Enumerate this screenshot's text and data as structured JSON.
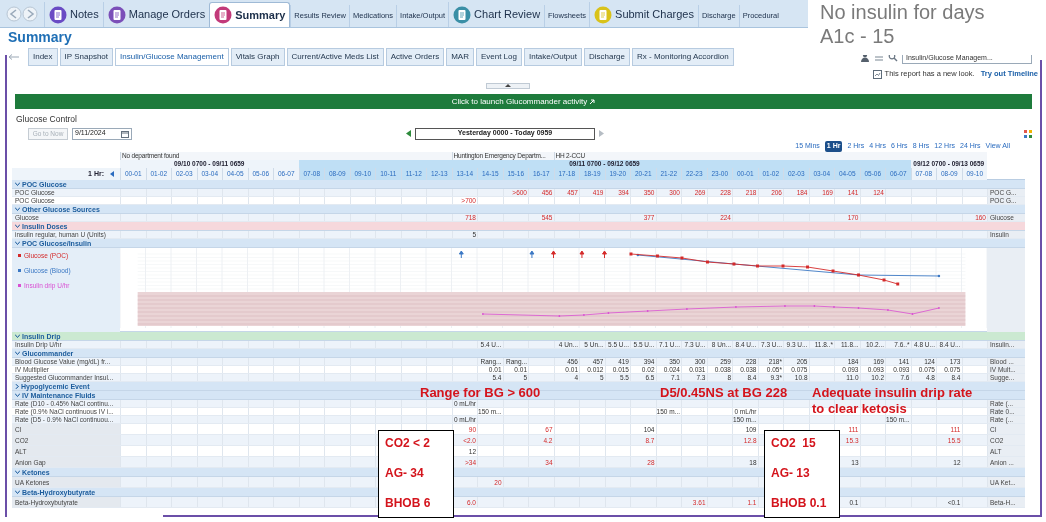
{
  "top_tabs": [
    {
      "label": "Notes",
      "kind": "large",
      "selected": false,
      "color": "#6a4bc4"
    },
    {
      "label": "Manage Orders",
      "kind": "large",
      "selected": false,
      "color": "#7b4fb8"
    },
    {
      "label": "Summary",
      "kind": "large",
      "selected": true,
      "color": "#c23a7a"
    },
    {
      "label": "Results Review",
      "kind": "small",
      "selected": false
    },
    {
      "label": "Medications",
      "kind": "small",
      "selected": false
    },
    {
      "label": "Intake/Output",
      "kind": "small",
      "selected": false
    },
    {
      "label": "Chart Review",
      "kind": "large",
      "selected": false,
      "color": "#3a8fa6"
    },
    {
      "label": "Flowsheets",
      "kind": "small",
      "selected": false
    },
    {
      "label": "Submit Charges",
      "kind": "large",
      "selected": false,
      "color": "#d9c21a"
    },
    {
      "label": "Discharge",
      "kind": "small",
      "selected": false
    },
    {
      "label": "Procedural",
      "kind": "small",
      "selected": false
    }
  ],
  "overlay_note": [
    "No insulin for days",
    "A1c - 15"
  ],
  "page_title": "Summary",
  "report_tabs": [
    {
      "label": "Index",
      "selected": false
    },
    {
      "label": "IP Snapshot",
      "selected": false
    },
    {
      "label": "Insulin/Glucose Management",
      "selected": true
    },
    {
      "label": "Vitals Graph",
      "selected": false
    },
    {
      "label": "Current/Active Meds List",
      "selected": false
    },
    {
      "label": "Active Orders",
      "selected": false
    },
    {
      "label": "MAR",
      "selected": false
    },
    {
      "label": "Event Log",
      "selected": false
    },
    {
      "label": "Intake/Output",
      "selected": false
    },
    {
      "label": "Discharge",
      "selected": false
    },
    {
      "label": "Rx - Monitoring Accordion",
      "selected": false
    }
  ],
  "report_search": {
    "value": "Insulin/Glucose Managem..."
  },
  "new_look": {
    "text": "This report has a new look.",
    "link": "Try out Timeline"
  },
  "launch_bar": "Click to launch Glucommander activity",
  "section_title": "Glucose Control",
  "go_to_now": {
    "label": "Go to Now",
    "disabled": true
  },
  "date_field": {
    "value": "9/11/2024"
  },
  "range_nav": "Yesterday 0000 - Today 0959",
  "intervals": [
    {
      "label": "15 Mins",
      "selected": false
    },
    {
      "label": "1 Hr",
      "selected": true
    },
    {
      "label": "2 Hrs",
      "selected": false
    },
    {
      "label": "4 Hrs",
      "selected": false
    },
    {
      "label": "6 Hrs",
      "selected": false
    },
    {
      "label": "8 Hrs",
      "selected": false
    },
    {
      "label": "12 Hrs",
      "selected": false
    },
    {
      "label": "24 Hrs",
      "selected": false
    },
    {
      "label": "View All",
      "selected": false
    }
  ],
  "department_cells": [
    "No department found",
    null,
    null,
    null,
    null,
    null,
    null,
    null,
    null,
    null,
    null,
    null,
    null,
    "Huntington Emergency Departm...",
    null,
    null,
    null,
    "HH 2-CCU",
    null,
    null,
    null,
    null,
    null,
    null,
    null,
    null,
    null,
    null,
    null,
    null,
    null,
    null,
    null,
    null
  ],
  "periods": [
    {
      "label": "09/10 0700 - 09/11 0659",
      "selected": false,
      "columns": [
        "00-01",
        "01-02",
        "02-03",
        "03-04",
        "04-05",
        "05-06",
        "06-07"
      ]
    },
    {
      "label": "09/11 0700 - 09/12 0659",
      "selected": true,
      "columns": [
        "07-08",
        "08-09",
        "09-10",
        "10-11",
        "11-12",
        "12-13",
        "13-14",
        "14-15",
        "15-16",
        "16-17",
        "17-18",
        "18-19",
        "19-20",
        "20-21",
        "21-22",
        "22-23",
        "23-00",
        "00-01",
        "01-02",
        "02-03",
        "03-04",
        "04-05",
        "05-06",
        "06-07"
      ]
    },
    {
      "label": "09/12 0700 - 09/13 0659",
      "selected": false,
      "columns": [
        "07-08",
        "08-09",
        "09-10"
      ]
    }
  ],
  "column_unit": "1 Hr:",
  "body": [
    {
      "kind": "section",
      "title": "POC Glucose",
      "expanded": true,
      "color": "#d5e5f5"
    },
    {
      "kind": "flowsheet",
      "label": "POC Glucose",
      "right_label": "POC G...",
      "cells": [
        null,
        null,
        null,
        null,
        null,
        null,
        null,
        null,
        null,
        null,
        null,
        null,
        null,
        null,
        null,
        {
          "text": ">600",
          "abnormal": true
        },
        {
          "text": "456",
          "abnormal": true
        },
        {
          "text": "457",
          "abnormal": true
        },
        {
          "text": "419",
          "abnormal": true
        },
        {
          "text": "394",
          "abnormal": true
        },
        {
          "text": "350",
          "abnormal": true
        },
        {
          "text": "300",
          "abnormal": true
        },
        {
          "text": "269",
          "abnormal": true
        },
        {
          "text": "228",
          "abnormal": true
        },
        {
          "text": "218",
          "abnormal": true
        },
        {
          "text": "206",
          "abnormal": true
        },
        {
          "text": "184",
          "abnormal": true
        },
        {
          "text": "169",
          "abnormal": true
        },
        {
          "text": "141",
          "abnormal": true
        },
        {
          "text": "124",
          "abnormal": true
        },
        null,
        null,
        null,
        null
      ]
    },
    {
      "kind": "flowsheet",
      "label": "POC Glucose",
      "right_label": "POC G...",
      "cells": [
        null,
        null,
        null,
        null,
        null,
        null,
        null,
        null,
        null,
        null,
        null,
        null,
        null,
        {
          "text": ">700",
          "abnormal": true
        },
        null,
        null,
        null,
        null,
        null,
        null,
        null,
        null,
        null,
        null,
        null,
        null,
        null,
        null,
        null,
        null,
        null,
        null,
        null,
        null
      ]
    },
    {
      "kind": "section",
      "title": "Other Glucose Sources",
      "expanded": true,
      "color": "#d5e5f5"
    },
    {
      "kind": "flowsheet",
      "label": "Glucose",
      "right_label": "Glucose",
      "cells": [
        null,
        null,
        null,
        null,
        null,
        null,
        null,
        null,
        null,
        null,
        null,
        null,
        null,
        {
          "text": "718",
          "abnormal": true
        },
        null,
        null,
        {
          "text": "545",
          "abnormal": true
        },
        null,
        null,
        null,
        {
          "text": "377",
          "abnormal": true
        },
        null,
        null,
        {
          "text": "224",
          "abnormal": true
        },
        null,
        null,
        null,
        null,
        {
          "text": "170",
          "abnormal": true
        },
        null,
        null,
        null,
        null,
        {
          "text": "160",
          "abnormal": true
        }
      ]
    },
    {
      "kind": "section",
      "title": "Insulin Doses",
      "expanded": true,
      "color": "#f6d8dc"
    },
    {
      "kind": "flowsheet",
      "label": "insulin regular, human U (Units)",
      "right_label": "Insulin",
      "cells": [
        null,
        null,
        null,
        null,
        null,
        null,
        null,
        null,
        null,
        null,
        null,
        null,
        null,
        {
          "text": "5",
          "abnormal": false
        },
        null,
        null,
        null,
        null,
        null,
        null,
        null,
        null,
        null,
        null,
        null,
        null,
        null,
        null,
        null,
        null,
        null,
        null,
        null,
        null
      ]
    },
    {
      "kind": "section",
      "title": "POC Glucose/Insulin",
      "expanded": true,
      "color": "#d5e5f5"
    },
    {
      "kind": "chart",
      "legend": [
        {
          "label": "Glucose (POC)",
          "color": "#d42a2a"
        },
        {
          "label": "Glucose (Blood)",
          "color": "#3b78c4"
        },
        {
          "label": "Insulin drip U/hr",
          "color": "#d94fd3"
        }
      ]
    },
    {
      "kind": "section",
      "title": "Insulin Drip",
      "expanded": true,
      "color": "#cbe9d1"
    },
    {
      "kind": "flowsheet",
      "label": "Insulin Drip U/hr",
      "right_label": "Insulin...",
      "cells": [
        null,
        null,
        null,
        null,
        null,
        null,
        null,
        null,
        null,
        null,
        null,
        null,
        null,
        null,
        {
          "text": "5.4 U...",
          "abnormal": false
        },
        null,
        null,
        {
          "text": "4 Un...",
          "abnormal": false
        },
        {
          "text": "5 Un...",
          "abnormal": false
        },
        {
          "text": "5.5 U...",
          "abnormal": false
        },
        {
          "text": "5.5 U...",
          "abnormal": false
        },
        {
          "text": "7.1 U...",
          "abnormal": false
        },
        {
          "text": "7.3 U...",
          "abnormal": false
        },
        {
          "text": "8 Un...",
          "abnormal": false
        },
        {
          "text": "8.4 U...",
          "abnormal": false
        },
        {
          "text": "7.3 U...",
          "abnormal": false
        },
        {
          "text": "9.3 U...",
          "abnormal": false
        },
        {
          "text": "11.8..*",
          "abnormal": false
        },
        {
          "text": "11.8...",
          "abnormal": false
        },
        {
          "text": "10.2...",
          "abnormal": false
        },
        {
          "text": "7.6..*",
          "abnormal": false
        },
        {
          "text": "4.8 U...",
          "abnormal": false
        },
        {
          "text": "8.4 U...",
          "abnormal": false
        },
        null
      ]
    },
    {
      "kind": "section",
      "title": "Glucommander",
      "expanded": true,
      "color": "#d5e5f5"
    },
    {
      "kind": "flowsheet",
      "label": "Blood Glucose Value (mg/dL) fr...",
      "right_label": "Blood ...",
      "cells": [
        null,
        null,
        null,
        null,
        null,
        null,
        null,
        null,
        null,
        null,
        null,
        null,
        null,
        null,
        {
          "text": "Rang...",
          "abnormal": false
        },
        {
          "text": "Rang...",
          "abnormal": false
        },
        null,
        {
          "text": "456",
          "abnormal": false
        },
        {
          "text": "457",
          "abnormal": false
        },
        {
          "text": "419",
          "abnormal": false
        },
        {
          "text": "394",
          "abnormal": false
        },
        {
          "text": "350",
          "abnormal": false
        },
        {
          "text": "300",
          "abnormal": false
        },
        {
          "text": "259",
          "abnormal": false
        },
        {
          "text": "228",
          "abnormal": false
        },
        {
          "text": "218*",
          "abnormal": false
        },
        {
          "text": "205",
          "abnormal": false
        },
        null,
        {
          "text": "184",
          "abnormal": false
        },
        {
          "text": "169",
          "abnormal": false
        },
        {
          "text": "141",
          "abnormal": false
        },
        {
          "text": "124",
          "abnormal": false
        },
        {
          "text": "173",
          "abnormal": false
        },
        null
      ]
    },
    {
      "kind": "flowsheet",
      "label": "IV Multiplier",
      "right_label": "IV Mult...",
      "cells": [
        null,
        null,
        null,
        null,
        null,
        null,
        null,
        null,
        null,
        null,
        null,
        null,
        null,
        null,
        {
          "text": "0.01",
          "abnormal": false
        },
        {
          "text": "0.01",
          "abnormal": false
        },
        null,
        {
          "text": "0.01",
          "abnormal": false
        },
        {
          "text": "0.012",
          "abnormal": false
        },
        {
          "text": "0.015",
          "abnormal": false
        },
        {
          "text": "0.02",
          "abnormal": false
        },
        {
          "text": "0.024",
          "abnormal": false
        },
        {
          "text": "0.031",
          "abnormal": false
        },
        {
          "text": "0.038",
          "abnormal": false
        },
        {
          "text": "0.038",
          "abnormal": false
        },
        {
          "text": "0.05*",
          "abnormal": false
        },
        {
          "text": "0.075",
          "abnormal": false
        },
        null,
        {
          "text": "0.093",
          "abnormal": false
        },
        {
          "text": "0.093",
          "abnormal": false
        },
        {
          "text": "0.093",
          "abnormal": false
        },
        {
          "text": "0.075",
          "abnormal": false
        },
        {
          "text": "0.075",
          "abnormal": false
        },
        null
      ]
    },
    {
      "kind": "flowsheet",
      "label": "Suggested Glucommander Insul...",
      "right_label": "Sugge...",
      "cells": [
        null,
        null,
        null,
        null,
        null,
        null,
        null,
        null,
        null,
        null,
        null,
        null,
        null,
        null,
        {
          "text": "5.4",
          "abnormal": false
        },
        {
          "text": "5",
          "abnormal": false
        },
        null,
        {
          "text": "4",
          "abnormal": false
        },
        {
          "text": "5",
          "abnormal": false
        },
        {
          "text": "5.5",
          "abnormal": false
        },
        {
          "text": "6.5",
          "abnormal": false
        },
        {
          "text": "7.1",
          "abnormal": false
        },
        {
          "text": "7.3",
          "abnormal": false
        },
        {
          "text": "8",
          "abnormal": false
        },
        {
          "text": "8.4",
          "abnormal": false
        },
        {
          "text": "9.3*",
          "abnormal": false
        },
        {
          "text": "10.8",
          "abnormal": false
        },
        null,
        {
          "text": "11.0",
          "abnormal": false
        },
        {
          "text": "10.2",
          "abnormal": false
        },
        {
          "text": "7.6",
          "abnormal": false
        },
        {
          "text": "4.8",
          "abnormal": false
        },
        {
          "text": "8.4",
          "abnormal": false
        },
        null
      ]
    },
    {
      "kind": "section",
      "title": "Hypoglycemic Event",
      "expanded": false,
      "color": "#d5e5f5"
    },
    {
      "kind": "section",
      "title": "IV Maintenance Fluids",
      "expanded": true,
      "color": "#d5e5f5"
    },
    {
      "kind": "flowsheet",
      "label": "Rate (D10 - 0.45% NaCl continu...",
      "right_label": "Rate (...",
      "cells": [
        null,
        null,
        null,
        null,
        null,
        null,
        null,
        null,
        null,
        null,
        null,
        null,
        null,
        {
          "text": "0 mL/hr",
          "abnormal": false
        },
        null,
        null,
        null,
        null,
        null,
        null,
        null,
        null,
        null,
        null,
        null,
        null,
        null,
        null,
        null,
        null,
        null,
        null,
        null,
        null
      ]
    },
    {
      "kind": "flowsheet",
      "label": "Rate (0.9% NaCl continuous IV i...",
      "right_label": "Rate 0...",
      "cells": [
        null,
        null,
        null,
        null,
        null,
        null,
        null,
        null,
        null,
        null,
        null,
        null,
        null,
        null,
        {
          "text": "150 m...",
          "abnormal": false
        },
        null,
        null,
        null,
        null,
        null,
        null,
        {
          "text": "150 m...",
          "abnormal": false
        },
        null,
        null,
        {
          "text": "0 mL/hr",
          "abnormal": false
        },
        null,
        null,
        null,
        null,
        null,
        null,
        null,
        null,
        null
      ]
    },
    {
      "kind": "flowsheet",
      "label": "Rate (D5 - 0.9% NaCl continuou...",
      "right_label": "Rate (...",
      "cells": [
        null,
        null,
        null,
        null,
        null,
        null,
        null,
        null,
        null,
        null,
        null,
        null,
        null,
        {
          "text": "0 mL/hr",
          "abnormal": false
        },
        null,
        null,
        null,
        null,
        null,
        null,
        null,
        null,
        null,
        null,
        {
          "text": "150 m...",
          "abnormal": false
        },
        null,
        null,
        null,
        null,
        null,
        {
          "text": "150 m...",
          "abnormal": false
        },
        null,
        null,
        null
      ]
    },
    {
      "kind": "lab",
      "label": "Cl",
      "right_label": "Cl",
      "cells": [
        null,
        null,
        null,
        null,
        null,
        null,
        null,
        null,
        null,
        null,
        null,
        null,
        null,
        {
          "text": "90",
          "abnormal": true
        },
        null,
        null,
        {
          "text": "67",
          "abnormal": true
        },
        null,
        null,
        null,
        {
          "text": "104",
          "abnormal": false
        },
        null,
        null,
        null,
        {
          "text": "109",
          "abnormal": false
        },
        null,
        null,
        null,
        {
          "text": "111",
          "abnormal": true
        },
        null,
        null,
        null,
        {
          "text": "111",
          "abnormal": true
        },
        null
      ]
    },
    {
      "kind": "lab",
      "label": "CO2",
      "right_label": "CO2",
      "cells": [
        null,
        null,
        null,
        null,
        null,
        null,
        null,
        null,
        null,
        null,
        null,
        null,
        null,
        {
          "text": "<2.0",
          "abnormal": true
        },
        null,
        null,
        {
          "text": "4.2",
          "abnormal": true
        },
        null,
        null,
        null,
        {
          "text": "8.7",
          "abnormal": true
        },
        null,
        null,
        null,
        {
          "text": "12.8",
          "abnormal": true
        },
        null,
        null,
        null,
        {
          "text": "15.3",
          "abnormal": true
        },
        null,
        null,
        null,
        {
          "text": "15.5",
          "abnormal": true
        },
        null
      ]
    },
    {
      "kind": "lab",
      "label": "ALT",
      "right_label": "ALT",
      "cells": [
        null,
        null,
        null,
        null,
        null,
        null,
        null,
        null,
        null,
        null,
        null,
        null,
        null,
        {
          "text": "12",
          "abnormal": false
        },
        null,
        null,
        null,
        null,
        null,
        null,
        null,
        null,
        null,
        null,
        null,
        null,
        null,
        null,
        null,
        null,
        null,
        null,
        null,
        null
      ]
    },
    {
      "kind": "lab",
      "label": "Anion Gap",
      "right_label": "Anion ...",
      "cells": [
        null,
        null,
        null,
        null,
        null,
        null,
        null,
        null,
        null,
        null,
        null,
        null,
        null,
        {
          "text": ">34",
          "abnormal": true
        },
        null,
        null,
        {
          "text": "34",
          "abnormal": true
        },
        null,
        null,
        null,
        {
          "text": "28",
          "abnormal": true
        },
        null,
        null,
        null,
        {
          "text": "18",
          "abnormal": false
        },
        null,
        null,
        null,
        {
          "text": "13",
          "abnormal": false
        },
        null,
        null,
        null,
        {
          "text": "12",
          "abnormal": false
        },
        null
      ]
    },
    {
      "kind": "section",
      "title": "Ketones",
      "expanded": true,
      "color": "#d5e5f5"
    },
    {
      "kind": "lab",
      "label": "UA Ketones",
      "right_label": "UA Ket...",
      "cells": [
        null,
        null,
        null,
        null,
        null,
        null,
        null,
        null,
        null,
        null,
        null,
        null,
        null,
        null,
        {
          "text": "20",
          "abnormal": true
        },
        null,
        null,
        null,
        null,
        null,
        null,
        null,
        null,
        null,
        null,
        null,
        null,
        null,
        null,
        null,
        null,
        null,
        null,
        null
      ]
    },
    {
      "kind": "section",
      "title": "Beta-Hydroxybutyrate",
      "expanded": true,
      "color": "#d5e5f5"
    },
    {
      "kind": "lab",
      "label": "Beta-Hydroxybutyrate",
      "right_label": "Beta-H...",
      "cells": [
        null,
        null,
        null,
        null,
        null,
        null,
        null,
        null,
        null,
        null,
        null,
        null,
        null,
        {
          "text": "6.0",
          "abnormal": true
        },
        null,
        null,
        null,
        null,
        null,
        null,
        null,
        null,
        {
          "text": "3.61",
          "abnormal": true
        },
        null,
        {
          "text": "1.1",
          "abnormal": true
        },
        null,
        null,
        null,
        {
          "text": "0.1",
          "abnormal": false
        },
        null,
        null,
        null,
        {
          "text": "<0.1",
          "abnormal": false
        },
        null
      ]
    }
  ],
  "annotations": [
    {
      "kind": "note",
      "lines": [
        "Range for BG > 600"
      ]
    },
    {
      "kind": "note",
      "lines": [
        "D5/0.45NS at BG 228"
      ]
    },
    {
      "kind": "note",
      "lines": [
        "Adequate insulin drip rate",
        "to clear ketosis"
      ]
    },
    {
      "kind": "box",
      "lines": [
        "CO2 < 2",
        "AG- 34",
        "BHOB 6"
      ]
    },
    {
      "kind": "box",
      "lines": [
        "CO2  15",
        "AG- 13",
        "BHOB 0.1"
      ]
    }
  ]
}
